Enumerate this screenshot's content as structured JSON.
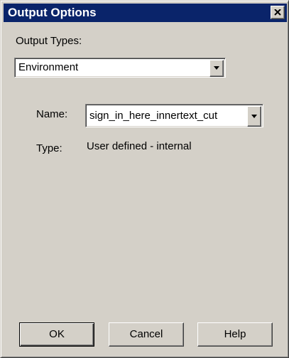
{
  "window": {
    "title": "Output Options",
    "close_symbol": "×"
  },
  "output_types": {
    "label": "Output Types:",
    "selected": "Environment"
  },
  "name_field": {
    "label": "Name:",
    "selected": "sign_in_here_innertext_cut"
  },
  "type_field": {
    "label": "Type:",
    "value": "User defined - internal"
  },
  "buttons": {
    "ok": "OK",
    "cancel": "Cancel",
    "help": "Help"
  },
  "icons": {
    "close": "close-icon",
    "dropdown": "chevron-down-icon"
  },
  "colors": {
    "titlebar": "#0a246a",
    "face": "#d4d0c8"
  }
}
